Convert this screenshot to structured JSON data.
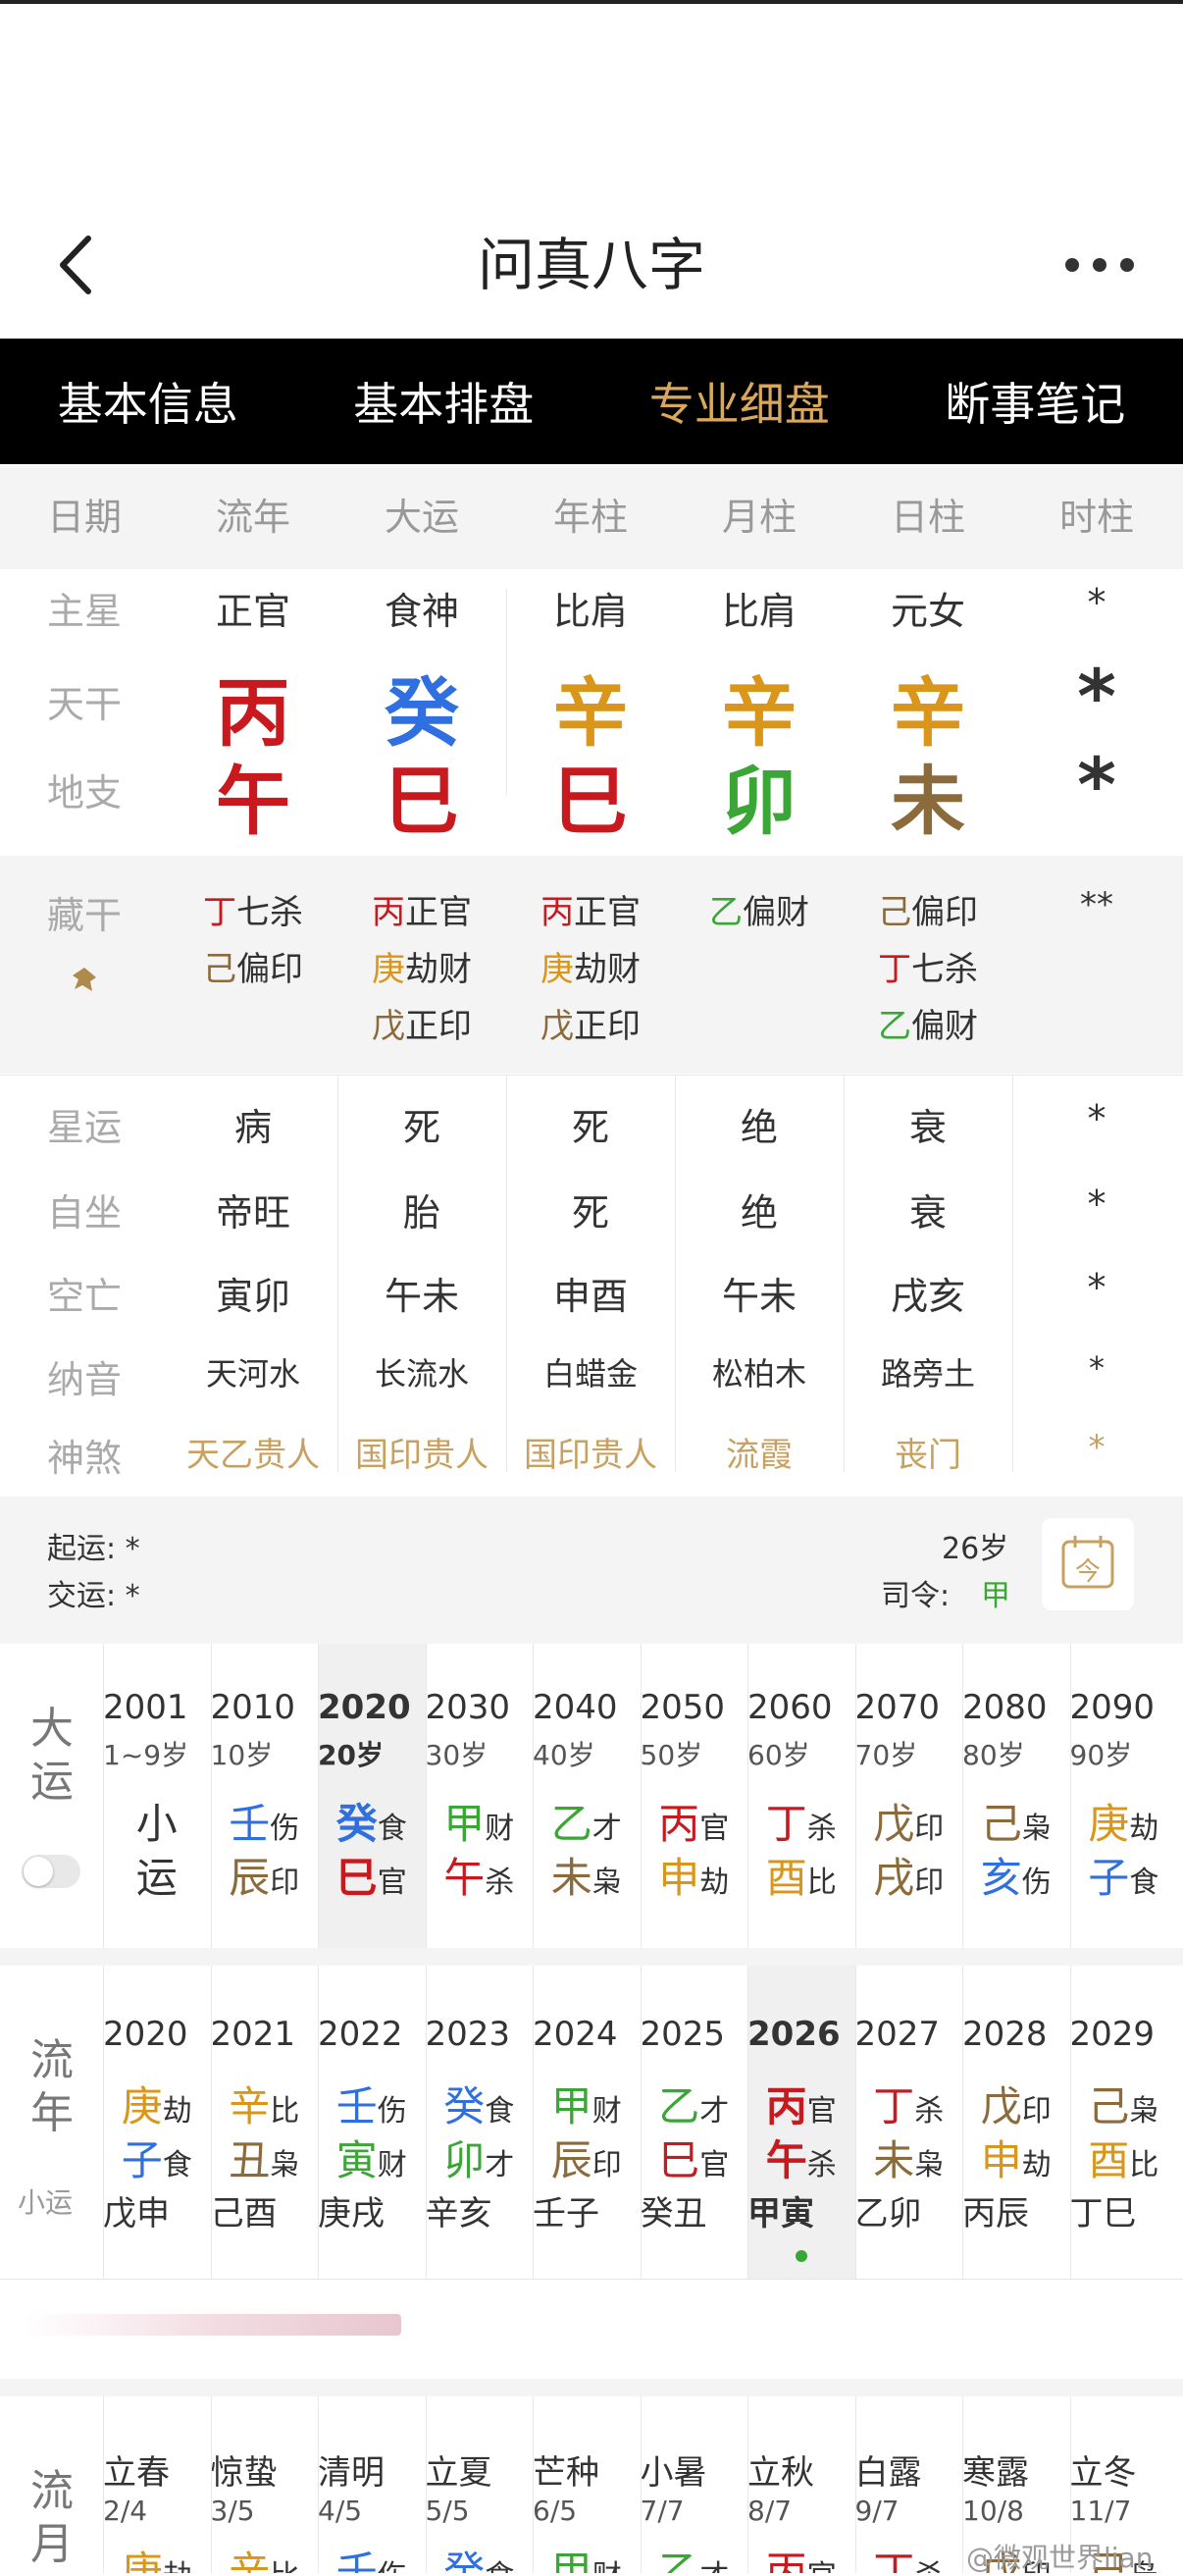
{
  "nav": {
    "title": "问真八字"
  },
  "tabs": [
    "基本信息",
    "基本排盘",
    "专业细盘",
    "断事笔记"
  ],
  "header": [
    "日期",
    "流年",
    "大运",
    "年柱",
    "月柱",
    "日柱",
    "时柱"
  ],
  "rows": {
    "zhuxing": {
      "label": "主星",
      "values": [
        "正官",
        "食神",
        "比肩",
        "比肩",
        "元女",
        "*"
      ]
    },
    "tiangan": {
      "label": "天干",
      "values": [
        "丙",
        "癸",
        "辛",
        "辛",
        "辛",
        "*"
      ]
    },
    "dizhi": {
      "label": "地支",
      "values": [
        "午",
        "巳",
        "巳",
        "卯",
        "未",
        "*"
      ]
    }
  },
  "canggan": {
    "label": "藏干",
    "cols": [
      [
        {
          "g": "丁",
          "t": "七杀"
        },
        {
          "g": "己",
          "t": "偏印"
        }
      ],
      [
        {
          "g": "丙",
          "t": "正官"
        },
        {
          "g": "庚",
          "t": "劫财"
        },
        {
          "g": "戊",
          "t": "正印"
        }
      ],
      [
        {
          "g": "丙",
          "t": "正官"
        },
        {
          "g": "庚",
          "t": "劫财"
        },
        {
          "g": "戊",
          "t": "正印"
        }
      ],
      [
        {
          "g": "乙",
          "t": "偏财"
        }
      ],
      [
        {
          "g": "己",
          "t": "偏印"
        },
        {
          "g": "丁",
          "t": "七杀"
        },
        {
          "g": "乙",
          "t": "偏财"
        }
      ],
      [
        {
          "g": "",
          "t": "**"
        }
      ]
    ]
  },
  "xingyun": {
    "label": "星运",
    "values": [
      "病",
      "死",
      "死",
      "绝",
      "衰",
      "*"
    ]
  },
  "zizuo": {
    "label": "自坐",
    "values": [
      "帝旺",
      "胎",
      "死",
      "绝",
      "衰",
      "*"
    ]
  },
  "kongwang": {
    "label": "空亡",
    "values": [
      "寅卯",
      "午未",
      "申酉",
      "午未",
      "戌亥",
      "*"
    ]
  },
  "nayin": {
    "label": "纳音",
    "values": [
      "天河水",
      "长流水",
      "白蜡金",
      "松柏木",
      "路旁土",
      "*"
    ]
  },
  "shensha": {
    "label": "神煞",
    "values": [
      "天乙贵人",
      "国印贵人",
      "国印贵人",
      "流霞",
      "丧门",
      "*"
    ]
  },
  "yunqi": {
    "qiyun": "起运: *",
    "jiaoyun": "交运: *",
    "age": "26岁",
    "siling_label": "司令:",
    "siling": "甲",
    "cal_icon": "今"
  },
  "dayun": {
    "label": [
      "大",
      "运"
    ],
    "items": [
      {
        "year": "2001",
        "age": "1~9岁",
        "g": "小",
        "gt": "",
        "z": "运",
        "zt": ""
      },
      {
        "year": "2010",
        "age": "10岁",
        "g": "壬",
        "gt": "伤",
        "z": "辰",
        "zt": "印"
      },
      {
        "year": "2020",
        "age": "20岁",
        "g": "癸",
        "gt": "食",
        "z": "巳",
        "zt": "官"
      },
      {
        "year": "2030",
        "age": "30岁",
        "g": "甲",
        "gt": "财",
        "z": "午",
        "zt": "杀"
      },
      {
        "year": "2040",
        "age": "40岁",
        "g": "乙",
        "gt": "才",
        "z": "未",
        "zt": "枭"
      },
      {
        "year": "2050",
        "age": "50岁",
        "g": "丙",
        "gt": "官",
        "z": "申",
        "zt": "劫"
      },
      {
        "year": "2060",
        "age": "60岁",
        "g": "丁",
        "gt": "杀",
        "z": "酉",
        "zt": "比"
      },
      {
        "year": "2070",
        "age": "70岁",
        "g": "戊",
        "gt": "印",
        "z": "戌",
        "zt": "印"
      },
      {
        "year": "2080",
        "age": "80岁",
        "g": "己",
        "gt": "枭",
        "z": "亥",
        "zt": "伤"
      },
      {
        "year": "2090",
        "age": "90岁",
        "g": "庚",
        "gt": "劫",
        "z": "子",
        "zt": "食"
      }
    ]
  },
  "liunian": {
    "label": [
      "流",
      "年"
    ],
    "sub": "小运",
    "items": [
      {
        "year": "2020",
        "g": "庚",
        "gt": "劫",
        "z": "子",
        "zt": "食",
        "x": "戊申"
      },
      {
        "year": "2021",
        "g": "辛",
        "gt": "比",
        "z": "丑",
        "zt": "枭",
        "x": "己酉"
      },
      {
        "year": "2022",
        "g": "壬",
        "gt": "伤",
        "z": "寅",
        "zt": "财",
        "x": "庚戌"
      },
      {
        "year": "2023",
        "g": "癸",
        "gt": "食",
        "z": "卯",
        "zt": "才",
        "x": "辛亥"
      },
      {
        "year": "2024",
        "g": "甲",
        "gt": "财",
        "z": "辰",
        "zt": "印",
        "x": "壬子"
      },
      {
        "year": "2025",
        "g": "乙",
        "gt": "才",
        "z": "巳",
        "zt": "官",
        "x": "癸丑"
      },
      {
        "year": "2026",
        "g": "丙",
        "gt": "官",
        "z": "午",
        "zt": "杀",
        "x": "甲寅"
      },
      {
        "year": "2027",
        "g": "丁",
        "gt": "杀",
        "z": "未",
        "zt": "枭",
        "x": "乙卯"
      },
      {
        "year": "2028",
        "g": "戊",
        "gt": "印",
        "z": "申",
        "zt": "劫",
        "x": "丙辰"
      },
      {
        "year": "2029",
        "g": "己",
        "gt": "枭",
        "z": "酉",
        "zt": "比",
        "x": "丁巳"
      }
    ]
  },
  "liuyue": {
    "label": [
      "流",
      "月"
    ],
    "items": [
      {
        "jie": "立春",
        "d": "2/4",
        "g": "庚",
        "gt": "劫"
      },
      {
        "jie": "惊蛰",
        "d": "3/5",
        "g": "辛",
        "gt": "比"
      },
      {
        "jie": "清明",
        "d": "4/5",
        "g": "壬",
        "gt": "伤"
      },
      {
        "jie": "立夏",
        "d": "5/5",
        "g": "癸",
        "gt": "食"
      },
      {
        "jie": "芒种",
        "d": "6/5",
        "g": "甲",
        "gt": "财"
      },
      {
        "jie": "小暑",
        "d": "7/7",
        "g": "乙",
        "gt": "才"
      },
      {
        "jie": "立秋",
        "d": "8/7",
        "g": "丙",
        "gt": "官"
      },
      {
        "jie": "白露",
        "d": "9/7",
        "g": "丁",
        "gt": "杀"
      },
      {
        "jie": "寒露",
        "d": "10/8",
        "g": "戊",
        "gt": "印"
      },
      {
        "jie": "立冬",
        "d": "11/7",
        "g": "己",
        "gt": "枭"
      }
    ]
  },
  "watermark": "@微观世界lian",
  "colors": {
    "fire": "#c8191f",
    "water": "#2f6fe0",
    "metal": "#d9961a",
    "wood": "#3aa635",
    "earth": "#8b6a3c",
    "accent": "#d9a85a"
  }
}
